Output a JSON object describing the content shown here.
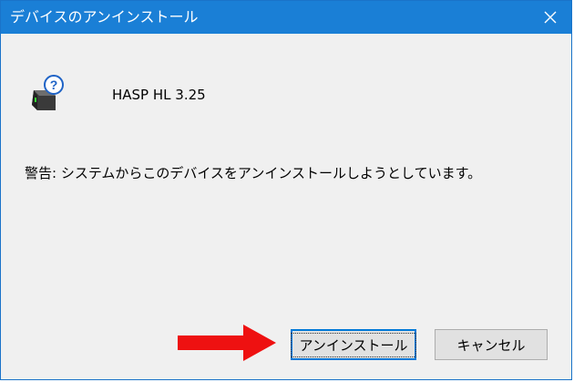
{
  "dialog": {
    "title": "デバイスのアンインストール",
    "device_name": "HASP HL 3.25",
    "warning": "警告: システムからこのデバイスをアンインストールしようとしています。",
    "uninstall_label": "アンインストール",
    "cancel_label": "キャンセル"
  },
  "icons": {
    "close": "close-icon",
    "device": "usb-device-question-icon",
    "arrow": "red-arrow-right-icon"
  },
  "colors": {
    "titlebar": "#1a7fd6",
    "dialog_bg": "#f0f0f0",
    "arrow": "#ee1111",
    "default_button_border": "#0078d7"
  }
}
